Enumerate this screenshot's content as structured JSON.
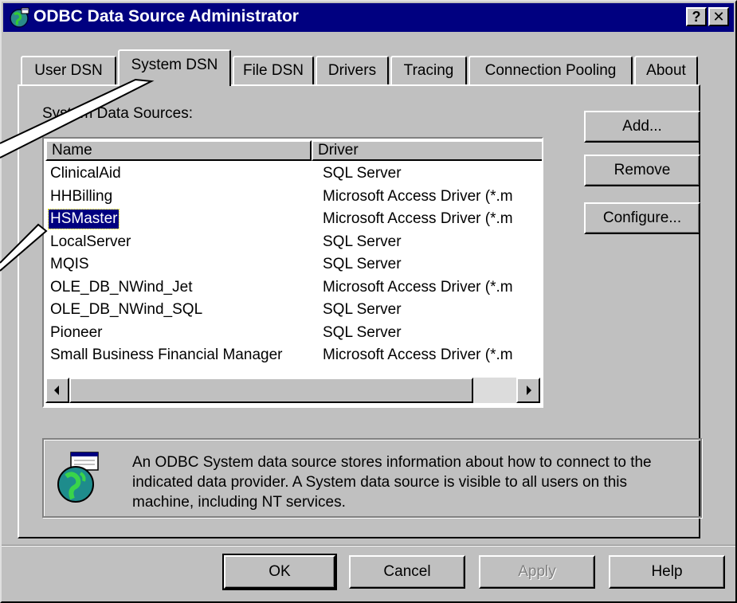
{
  "window": {
    "title": "ODBC Data Source Administrator",
    "help_glyph": "?",
    "close_glyph": "✕"
  },
  "tabs": [
    {
      "label": "User DSN",
      "active": false
    },
    {
      "label": "System DSN",
      "active": true
    },
    {
      "label": "File DSN",
      "active": false
    },
    {
      "label": "Drivers",
      "active": false
    },
    {
      "label": "Tracing",
      "active": false
    },
    {
      "label": "Connection Pooling",
      "active": false
    },
    {
      "label": "About",
      "active": false
    }
  ],
  "data_sources": {
    "label": "System Data Sources:",
    "columns": [
      "Name",
      "Driver"
    ],
    "rows": [
      {
        "name": "ClinicalAid",
        "driver": "SQL Server",
        "selected": false
      },
      {
        "name": "HHBilling",
        "driver": "Microsoft Access Driver (*.m",
        "selected": false
      },
      {
        "name": "HSMaster",
        "driver": "Microsoft Access Driver (*.m",
        "selected": true
      },
      {
        "name": "LocalServer",
        "driver": "SQL Server",
        "selected": false
      },
      {
        "name": "MQIS",
        "driver": "SQL Server",
        "selected": false
      },
      {
        "name": "OLE_DB_NWind_Jet",
        "driver": "Microsoft Access Driver (*.m",
        "selected": false
      },
      {
        "name": "OLE_DB_NWind_SQL",
        "driver": "SQL Server",
        "selected": false
      },
      {
        "name": "Pioneer",
        "driver": "SQL Server",
        "selected": false
      },
      {
        "name": "Small Business Financial Manager",
        "driver": "Microsoft Access Driver (*.m",
        "selected": false
      }
    ]
  },
  "side_buttons": {
    "add": "Add...",
    "remove": "Remove",
    "configure": "Configure..."
  },
  "info": {
    "text": "An ODBC System data source stores information about how to connect to the indicated data provider.   A System data source is visible to all users on this machine, including NT services.",
    "icon": "odbc-globe-icon"
  },
  "footer_buttons": {
    "ok": "OK",
    "cancel": "Cancel",
    "apply": "Apply",
    "help": "Help"
  },
  "colors": {
    "titlebar": "#000080",
    "face": "#c0c0c0",
    "selection": "#000080"
  }
}
